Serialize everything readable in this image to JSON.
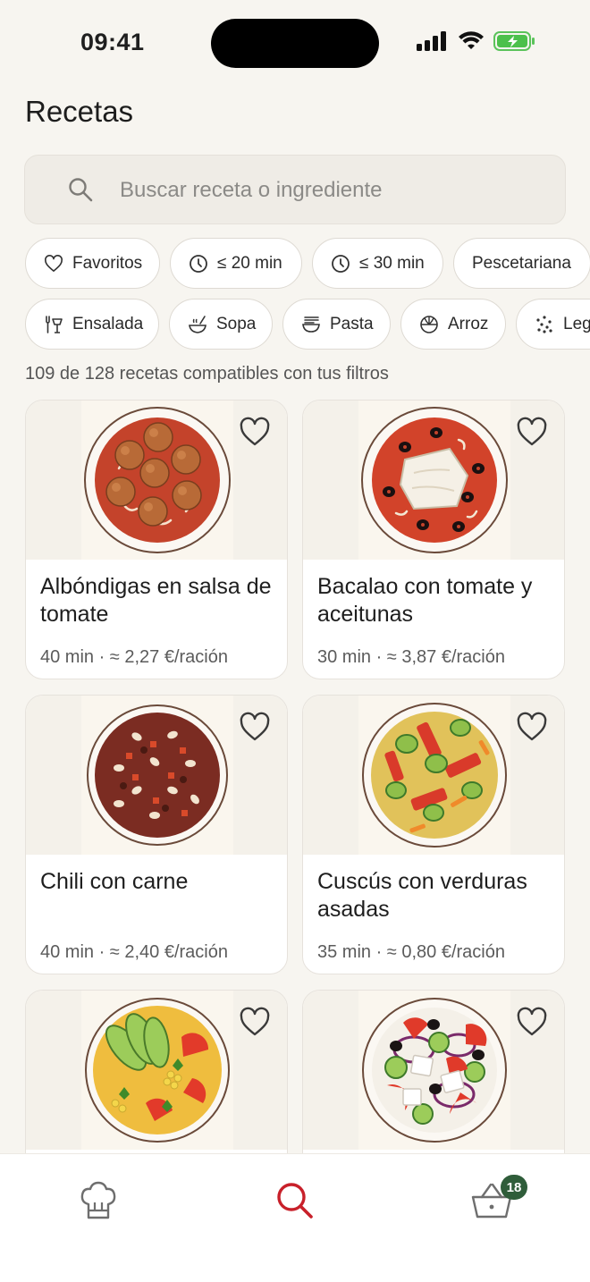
{
  "status_bar": {
    "time": "09:41"
  },
  "page": {
    "title": "Recetas"
  },
  "search": {
    "placeholder": "Buscar receta o ingrediente"
  },
  "filters": {
    "row1": [
      {
        "label": "Favoritos",
        "icon": "heart-icon"
      },
      {
        "label": "≤ 20 min",
        "icon": "clock-icon"
      },
      {
        "label": "≤ 30 min",
        "icon": "clock-icon"
      },
      {
        "label": "Pescetariana",
        "icon": ""
      }
    ],
    "row2": [
      {
        "label": "Ensalada",
        "icon": "salad-utensils-icon"
      },
      {
        "label": "Sopa",
        "icon": "soup-bowl-icon"
      },
      {
        "label": "Pasta",
        "icon": "noodles-icon"
      },
      {
        "label": "Arroz",
        "icon": "rice-bowl-icon"
      },
      {
        "label": "Leg",
        "icon": "legumes-icon"
      }
    ]
  },
  "results": {
    "count_text": "109 de 128 recetas compatibles con tus filtros"
  },
  "recipes": [
    {
      "title": "Albóndigas en salsa de tomate",
      "meta": "40 min · ≈ 2,27 €/ración",
      "image": "meatballs-tomato-dish"
    },
    {
      "title": "Bacalao con tomate y aceitunas",
      "meta": "30 min · ≈ 3,87 €/ración",
      "image": "cod-tomato-olives-dish"
    },
    {
      "title": "Chili con carne",
      "meta": "40 min · ≈ 2,40 €/ración",
      "image": "chili-con-carne-dish"
    },
    {
      "title": "Cuscús con verduras asadas",
      "meta": "35 min · ≈ 0,80 €/ración",
      "image": "couscous-vegetables-dish"
    },
    {
      "title": "",
      "meta": "",
      "image": "avocado-tomato-dish"
    },
    {
      "title": "",
      "meta": "",
      "image": "greek-salad-dish"
    }
  ],
  "tab_bar": {
    "tabs": [
      {
        "name": "chef-hat-icon",
        "active": false
      },
      {
        "name": "search-icon",
        "active": true
      },
      {
        "name": "basket-icon",
        "active": false
      }
    ],
    "basket_badge": "18"
  },
  "colors": {
    "accent": "#c8202a",
    "badge": "#2f5d3a",
    "background": "#f7f5f0"
  }
}
